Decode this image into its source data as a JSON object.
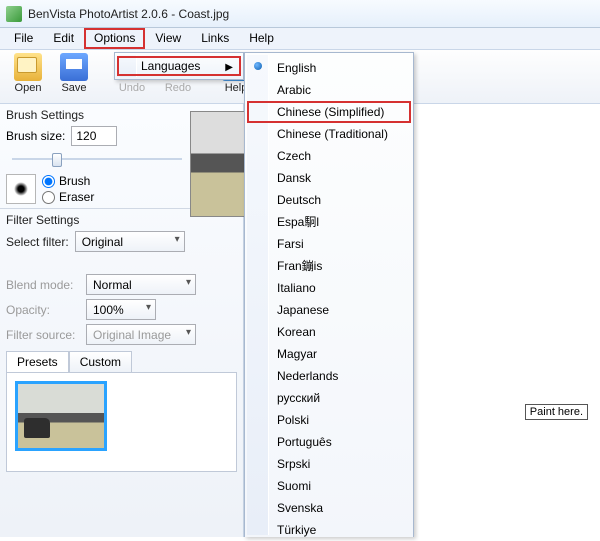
{
  "title": "BenVista PhotoArtist 2.0.6 - Coast.jpg",
  "menubar": {
    "file": "File",
    "edit": "Edit",
    "options": "Options",
    "view": "View",
    "links": "Links",
    "help": "Help"
  },
  "toolbar": {
    "open": "Open",
    "save": "Save",
    "undo": "Undo",
    "redo": "Redo",
    "help": "Help"
  },
  "submenu": {
    "languages": "Languages"
  },
  "languages": [
    "English",
    "Arabic",
    "Chinese (Simplified)",
    "Chinese (Traditional)",
    "Czech",
    "Dansk",
    "Deutsch",
    "Espa駉l",
    "Farsi",
    "Fran鏰is",
    "Italiano",
    "Japanese",
    "Korean",
    "Magyar",
    "Nederlands",
    "русский",
    "Polski",
    "Português",
    "Srpski",
    "Suomi",
    "Svenska",
    "Türkiye"
  ],
  "current_language_index": 0,
  "highlighted_language_index": 2,
  "brush": {
    "settings_title": "Brush Settings",
    "size_label": "Brush size:",
    "size_value": "120",
    "brush": "Brush",
    "eraser": "Eraser"
  },
  "filter": {
    "settings_title": "Filter Settings",
    "select_label": "Select filter:",
    "select_value": "Original",
    "blend_label": "Blend mode:",
    "blend_value": "Normal",
    "opacity_label": "Opacity:",
    "opacity_value": "100%",
    "source_label": "Filter source:",
    "source_value": "Original Image"
  },
  "tabs": {
    "presets": "Presets",
    "custom": "Custom"
  },
  "canvas_hint": "Paint here."
}
